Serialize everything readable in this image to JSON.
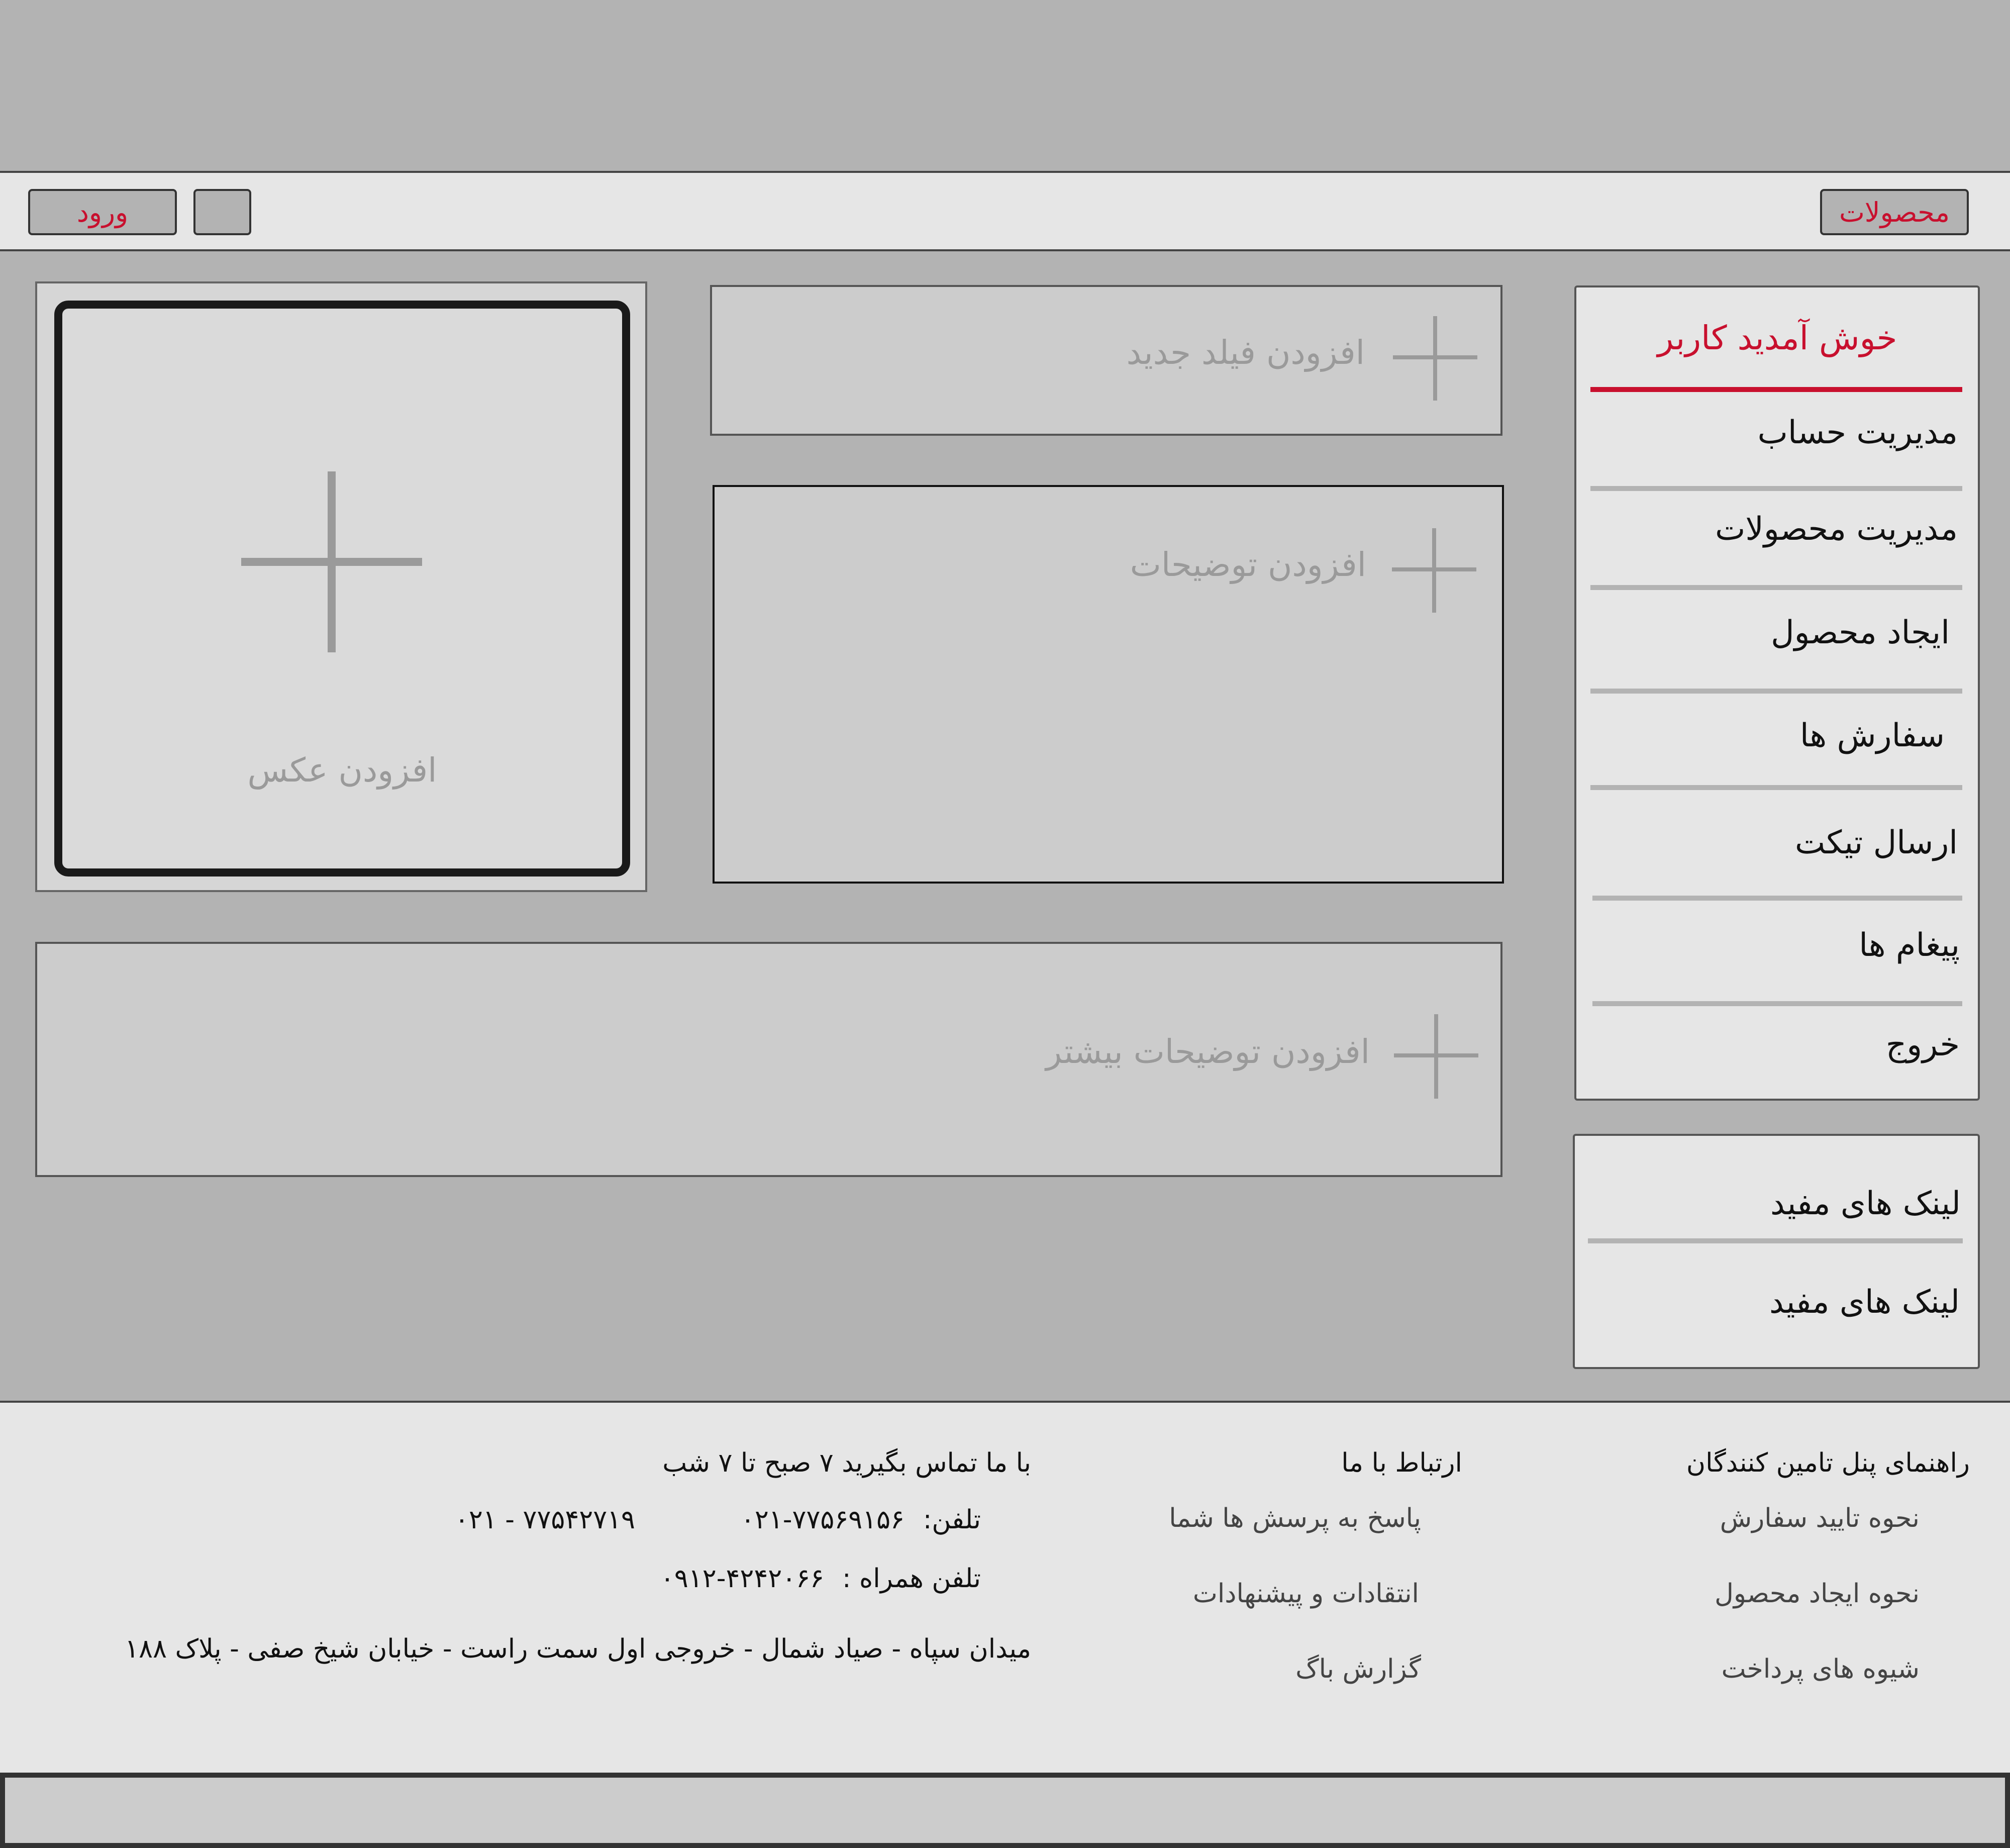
{
  "nav": {
    "products_label": "محصولات",
    "login_label": "ورود"
  },
  "sidebar": {
    "welcome": "خوش آمدید کاربر",
    "items": [
      {
        "label": "مدیریت حساب"
      },
      {
        "label": "مدیریت محصولات"
      },
      {
        "label": "ایجاد محصول"
      },
      {
        "label": "سفارش ها"
      },
      {
        "label": "ارسال تیکت"
      },
      {
        "label": "پیغام ها"
      },
      {
        "label": "خروج"
      }
    ],
    "useful_links": [
      {
        "label": "لینک های مفید"
      },
      {
        "label": "لینک های مفید"
      }
    ]
  },
  "editor": {
    "add_photo": "افزودن عکس",
    "add_field": "افزودن فیلد جدید",
    "add_description": "افزودن توضیحات",
    "add_more_description": "افزودن توضیحات بیشتر"
  },
  "footer": {
    "guide": {
      "title": "راهنمای پنل تامین کنندگان",
      "links": [
        {
          "label": "نحوه تایید سفارش"
        },
        {
          "label": "نحوه ایجاد محصول"
        },
        {
          "label": "شیوه های پرداخت"
        }
      ]
    },
    "contact_us": {
      "title": "ارتباط با ما",
      "links": [
        {
          "label": "پاسخ به پرسش ها شما"
        },
        {
          "label": "انتقادات و پیشنهادات"
        },
        {
          "label": "گزارش باگ"
        }
      ]
    },
    "call": {
      "title": "با ما تماس بگیرید ۷ صبح تا ۷ شب",
      "phone_label": "تلفن:",
      "phone_1": "۰۲۱-۷۷۵۶۹۱۵۶",
      "phone_2": "۰۲۱ - ۷۷۵۴۲۷۱۹",
      "mobile_label": "تلفن همراه :",
      "mobile": "۰۹۱۲-۴۲۴۲۰۶۶",
      "address": "میدان سپاه - صیاد شمال - خروجی اول سمت راست - خیابان شیخ صفی - پلاک ۱۸۸"
    }
  }
}
